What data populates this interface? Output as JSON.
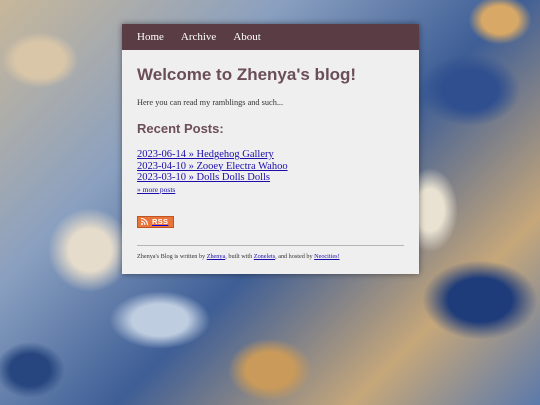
{
  "nav": {
    "items": [
      "Home",
      "Archive",
      "About"
    ]
  },
  "main": {
    "title": "Welcome to Zhenya's blog!",
    "intro": "Here you can read my ramblings and such...",
    "recent_heading": "Recent Posts:",
    "posts": [
      "2023-06-14 » Hedgehog Gallery",
      "2023-04-10 » Zooey Electra Wahoo",
      "2023-03-10 » Dolls Dolls Dolls"
    ],
    "more_posts": "» more posts"
  },
  "rss": {
    "label": "RSS",
    "icon": "rss-feed-icon",
    "color": "#e8743b"
  },
  "footer": {
    "t1": "Zhenya's Blog is written by ",
    "author": "Zhenya",
    "t2": ", built with ",
    "tool": "Zonelets",
    "t3": ", and hosted by ",
    "host": "Neocities!"
  },
  "colors": {
    "nav_bg": "#5a3d44",
    "heading": "#6b4e57",
    "link": "#1a0dab",
    "panel_bg": "#efefef"
  }
}
